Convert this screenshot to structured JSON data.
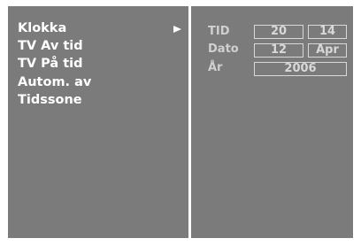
{
  "menu": {
    "items": [
      {
        "label": "Klokka",
        "selected": true
      },
      {
        "label": "TV Av tid"
      },
      {
        "label": "TV På tid"
      },
      {
        "label": "Autom. av"
      },
      {
        "label": "Tidssone"
      }
    ],
    "selected_indicator_icon": "right-triangle-icon"
  },
  "clock": {
    "time_label": "TID",
    "hour": "20",
    "minute": "14",
    "date_label": "Dato",
    "day": "12",
    "month": "Apr",
    "year_label": "År",
    "year": "2006"
  },
  "colors": {
    "panel": "#7b7b7b",
    "background": "#ffffff",
    "menu_text": "#ffffff",
    "field_text": "#d8d8d8"
  }
}
